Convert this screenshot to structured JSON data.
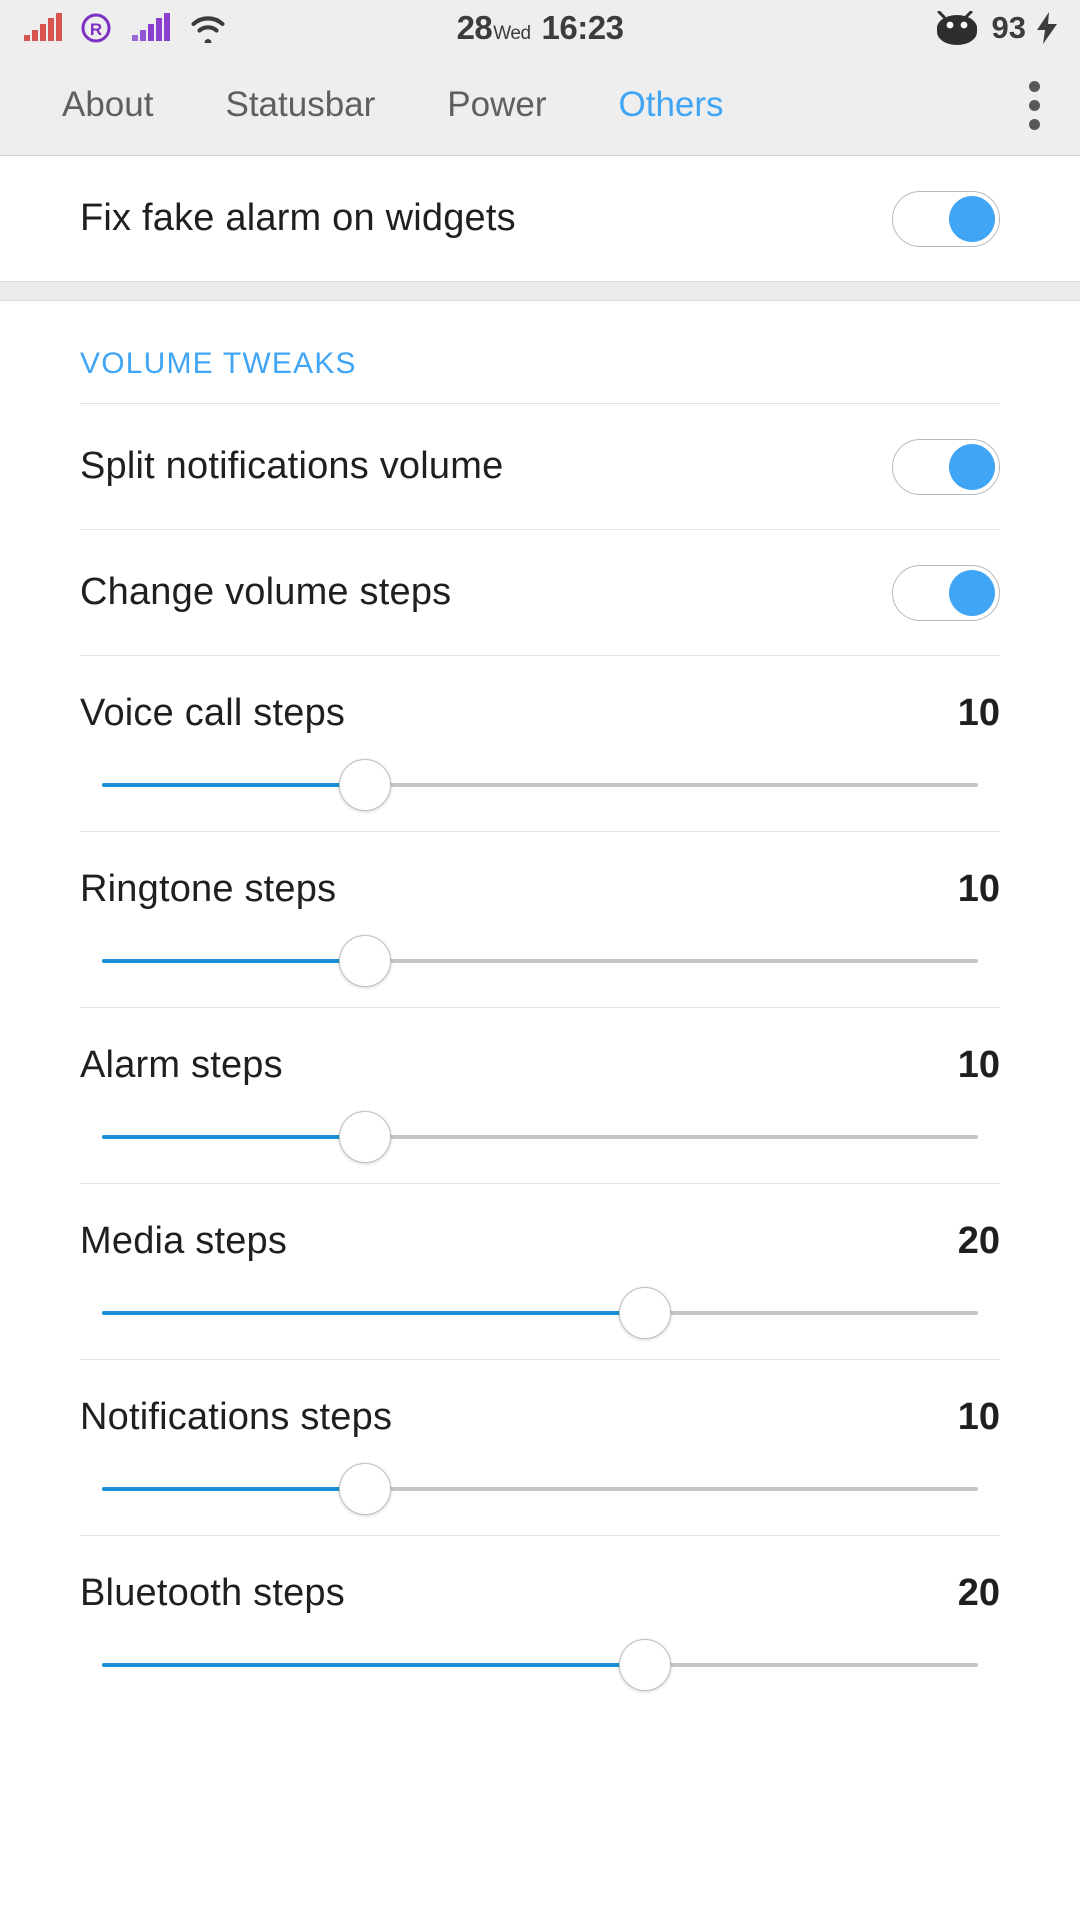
{
  "statusbar": {
    "icons_left": [
      "signal-bars-sim1-icon",
      "roaming-icon",
      "signal-bars-sim2-icon",
      "wifi-icon"
    ],
    "date_day": "28",
    "date_weekday": "Wed",
    "time": "16:23",
    "battery_icon": "android-bugdroid-battery-icon",
    "battery_level": "93",
    "charging_icon": "lightning-bolt-icon",
    "colors": {
      "sim1": "#d9534f",
      "roaming": "#7e2fc4",
      "sim2": "#8a3fd1",
      "wifi": "#3c3c3c",
      "background": "#eeeeee",
      "text": "#3c3c3c"
    }
  },
  "tabbar": {
    "tabs": [
      {
        "label": "About",
        "active": false
      },
      {
        "label": "Statusbar",
        "active": false
      },
      {
        "label": "Power",
        "active": false
      },
      {
        "label": "Others",
        "active": true
      }
    ],
    "overflow_icon": "more-vertical-icon",
    "active_color": "#41a5f5",
    "inactive_color": "#5f5f5f"
  },
  "content": {
    "top_toggle": {
      "label": "Fix fake alarm on widgets",
      "state": "on"
    },
    "section": {
      "header": "VOLUME TWEAKS",
      "toggles": [
        {
          "label": "Split notifications volume",
          "state": "on"
        },
        {
          "label": "Change volume steps",
          "state": "on"
        }
      ],
      "sliders": [
        {
          "label": "Voice call steps",
          "value": "10",
          "percent": 30
        },
        {
          "label": "Ringtone steps",
          "value": "10",
          "percent": 30
        },
        {
          "label": "Alarm steps",
          "value": "10",
          "percent": 30
        },
        {
          "label": "Media steps",
          "value": "20",
          "percent": 62
        },
        {
          "label": "Notifications steps",
          "value": "10",
          "percent": 30
        },
        {
          "label": "Bluetooth steps",
          "value": "20",
          "percent": 62
        }
      ]
    }
  },
  "theme": {
    "accent_blue": "#41a5f5",
    "slider_fill": "#1a8fd8",
    "text_primary": "#1f1f1f",
    "divider": "#e2e2e2"
  }
}
